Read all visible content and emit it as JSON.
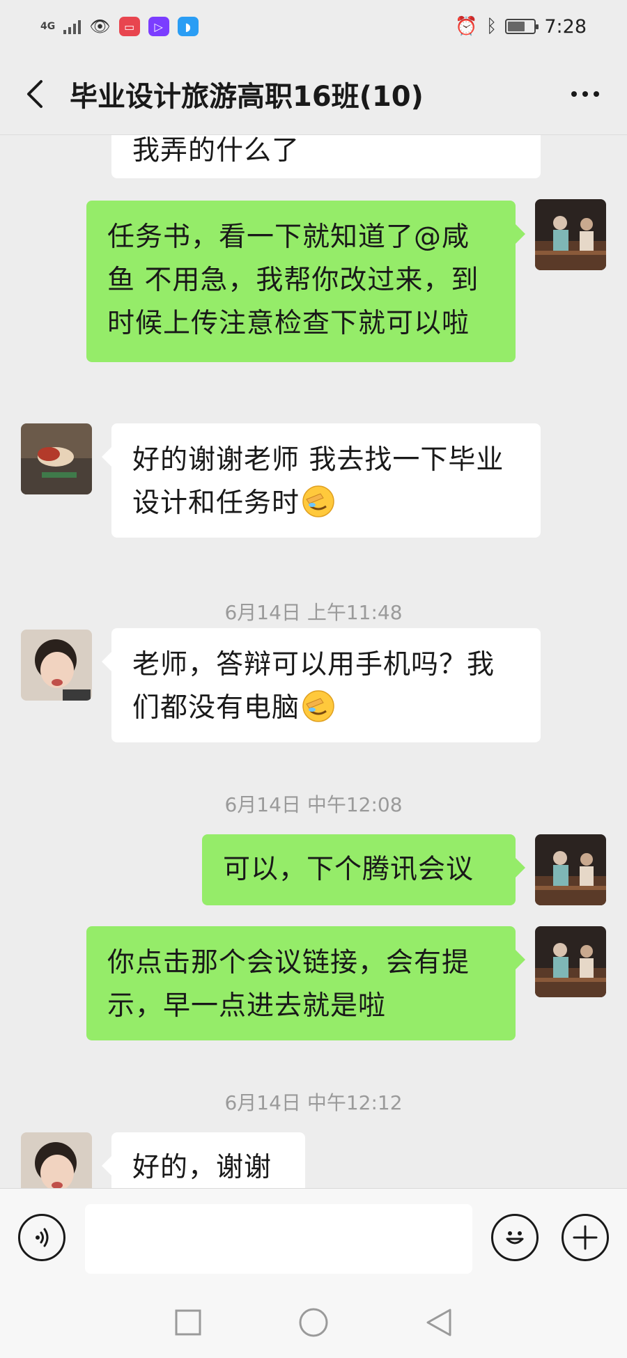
{
  "status_bar": {
    "network": "4G",
    "time": "7:28",
    "battery_level": 0.65
  },
  "header": {
    "title": "毕业设计旅游高职16班(10)"
  },
  "messages": [
    {
      "side": "left",
      "text": "我弄的什么了"
    },
    {
      "side": "right",
      "text": "任务书，看一下就知道了@咸鱼  不用急，我帮你改过来，到时候上传注意检查下就可以啦"
    },
    {
      "side": "left",
      "text": "好的谢谢老师 我去找一下毕业设计和任务时",
      "emoji": "facepalm-emoji"
    },
    {
      "type": "timestamp",
      "text": "6月14日 上午11:48"
    },
    {
      "side": "left",
      "text": "老师，答辩可以用手机吗？我们都没有电脑",
      "emoji": "facepalm-emoji"
    },
    {
      "type": "timestamp",
      "text": "6月14日 中午12:08"
    },
    {
      "side": "right",
      "text": "可以，下个腾讯会议"
    },
    {
      "side": "right",
      "text": "你点击那个会议链接，会有提示，早一点进去就是啦"
    },
    {
      "type": "timestamp",
      "text": "6月14日 中午12:12"
    },
    {
      "side": "left",
      "text": "好的，谢谢"
    }
  ],
  "input_bar": {
    "value": ""
  },
  "colors": {
    "self_bubble": "#95ec69",
    "other_bubble": "#ffffff",
    "background": "#ededed"
  }
}
